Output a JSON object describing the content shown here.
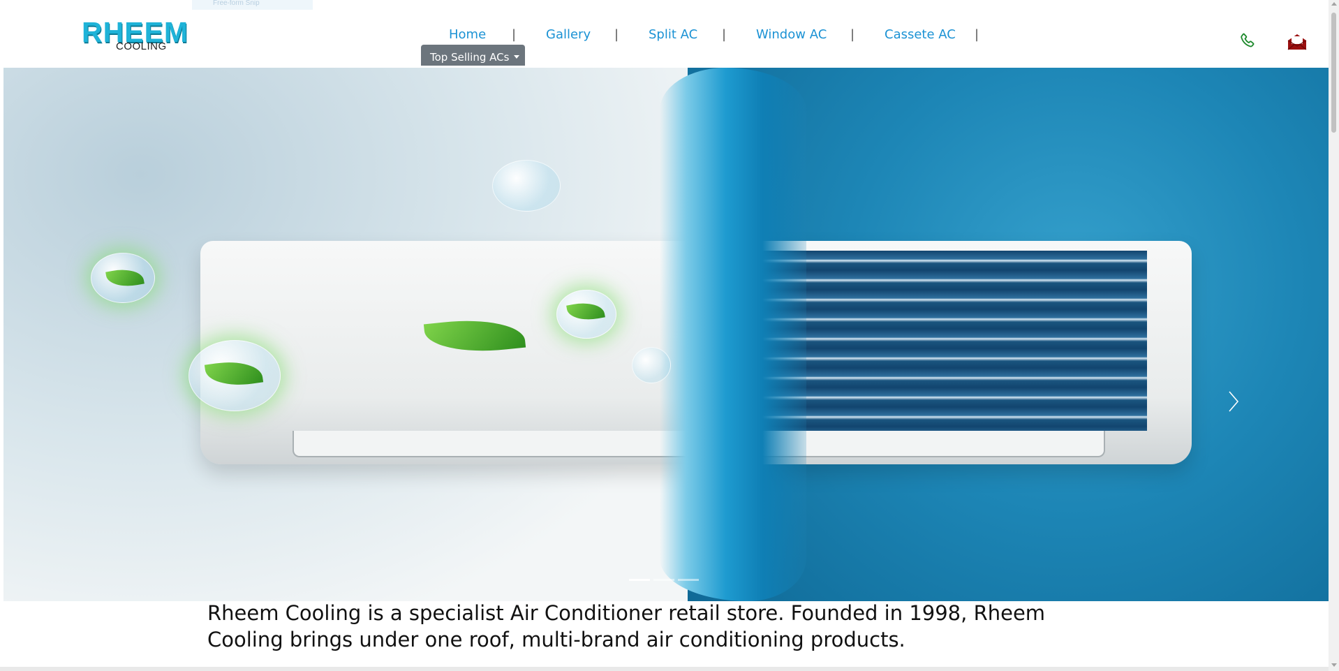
{
  "header": {
    "logo": {
      "main": "RHEEM",
      "sub": "COOLING"
    },
    "ghost_chip": "Free-form Snip",
    "nav": [
      {
        "label": "Home"
      },
      {
        "label": "Gallery"
      },
      {
        "label": "Split AC"
      },
      {
        "label": "Window AC"
      },
      {
        "label": "Cassete AC"
      }
    ],
    "separator": "|",
    "dropdown_label": "Top Selling ACs",
    "icons": {
      "phone": "phone-icon",
      "mail": "mail-icon"
    },
    "colors": {
      "nav_link": "#1b92d4",
      "dropdown_bg": "#6c757d",
      "phone": "#1f8a2e",
      "mail": "#9b1010"
    }
  },
  "carousel": {
    "next_icon": "chevron-right-icon",
    "slide_count": 3,
    "active_index": 0
  },
  "intro": {
    "text": "Rheem Cooling is a specialist Air Conditioner retail store. Founded in 1998, Rheem Cooling brings under one roof, multi-brand air conditioning products."
  }
}
